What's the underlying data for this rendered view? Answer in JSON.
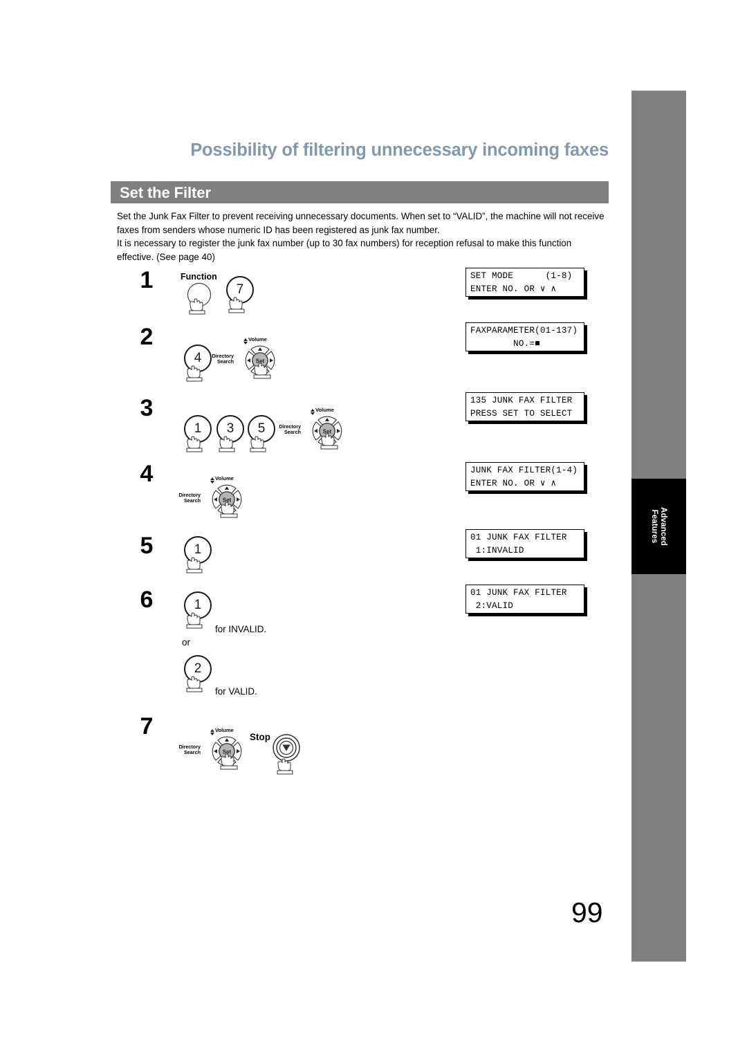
{
  "document": {
    "title": "Possibility of filtering unnecessary incoming faxes",
    "section_heading": "Set the Filter",
    "intro_paragraph_1": "Set the Junk Fax Filter to prevent receiving unnecessary documents. When set to “VALID”, the machine will not receive faxes from senders whose numeric ID has been registered as junk fax number.",
    "intro_paragraph_2": "It is necessary to register the junk fax number (up to 30 fax numbers) for reception refusal to make this function effective. (See page 40)",
    "page_number": "99",
    "title_color": "#8099ad",
    "bar_color": "#808080",
    "tab_color": "#000000"
  },
  "sidebar": {
    "tab_line_1": "Advanced",
    "tab_line_2": "Features"
  },
  "controls": {
    "function_label": "Function",
    "set_label": "Set",
    "volume_label": "Volume",
    "directory_line_1": "Directory",
    "directory_line_2": "Search",
    "stop_label": "Stop"
  },
  "steps": [
    {
      "number": "1",
      "keys": [
        "7"
      ]
    },
    {
      "number": "2",
      "keys": [
        "4"
      ]
    },
    {
      "number": "3",
      "keys": [
        "1",
        "3",
        "5"
      ]
    },
    {
      "number": "4",
      "keys": []
    },
    {
      "number": "5",
      "keys": [
        "1"
      ]
    },
    {
      "number": "6",
      "keys": [
        "1",
        "2"
      ]
    },
    {
      "number": "7",
      "keys": []
    }
  ],
  "step6_notes": {
    "invalid": "for INVALID.",
    "or": "or",
    "valid": "for VALID."
  },
  "lcd_displays": [
    {
      "line1": "SET MODE      (1-8)",
      "line2": "ENTER NO. OR ∨ ∧"
    },
    {
      "line1": "FAXPARAMETER(01-137)",
      "line2": "        NO.=■"
    },
    {
      "line1": "135 JUNK FAX FILTER",
      "line2": "PRESS SET TO SELECT"
    },
    {
      "line1": "JUNK FAX FILTER(1-4)",
      "line2": "ENTER NO. OR ∨ ∧"
    },
    {
      "line1": "01 JUNK FAX FILTER",
      "line2": " 1:INVALID"
    },
    {
      "line1": "01 JUNK FAX FILTER",
      "line2": " 2:VALID"
    }
  ]
}
